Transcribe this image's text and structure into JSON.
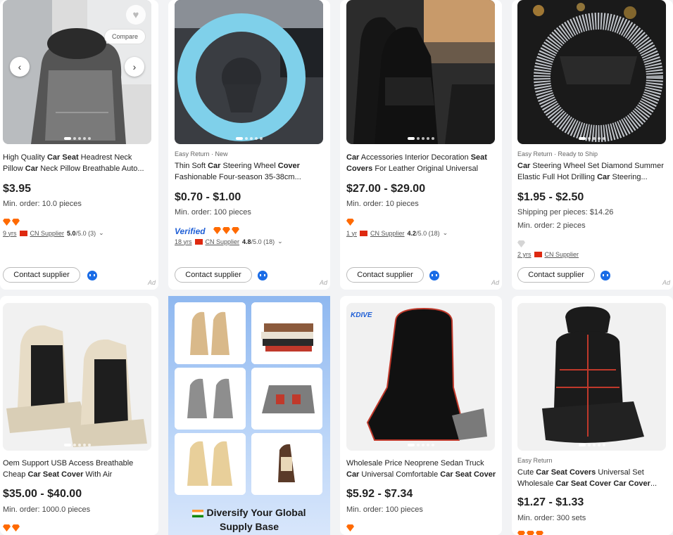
{
  "products": [
    {
      "tag": "",
      "title_parts": [
        {
          "t": "High Quality ",
          "b": false
        },
        {
          "t": "Car Seat",
          "b": true
        },
        {
          "t": " Headrest Neck Pillow ",
          "b": false
        },
        {
          "t": "Car",
          "b": true
        },
        {
          "t": " Neck Pillow Breathable Auto...",
          "b": false
        }
      ],
      "price": "$3.95",
      "moq": "Min. order: 10.0 pieces",
      "supplier": {
        "years": "9 yrs",
        "country": "CN Supplier",
        "rating": "5.0",
        "rating_of": "/5.0 (3)"
      },
      "contact": "Contact supplier",
      "ad": "Ad",
      "compare": "Compare"
    },
    {
      "tag": "Easy Return · New",
      "title_parts": [
        {
          "t": "Thin Soft ",
          "b": false
        },
        {
          "t": "Car",
          "b": true
        },
        {
          "t": " Steering Wheel ",
          "b": false
        },
        {
          "t": "Cover",
          "b": true
        },
        {
          "t": " Fashionable Four-season 35-38cm...",
          "b": false
        }
      ],
      "price": "$0.70 - $1.00",
      "moq": "Min. order: 100 pieces",
      "verified": "Verified",
      "supplier": {
        "years": "18 yrs",
        "country": "CN Supplier",
        "rating": "4.8",
        "rating_of": "/5.0 (18)"
      },
      "contact": "Contact supplier",
      "ad": "Ad"
    },
    {
      "tag": "",
      "title_parts": [
        {
          "t": "Car",
          "b": true
        },
        {
          "t": " Accessories Interior Decoration ",
          "b": false
        },
        {
          "t": "Seat Covers",
          "b": true
        },
        {
          "t": " For Leather Original Universal",
          "b": false
        }
      ],
      "price": "$27.00 - $29.00",
      "moq": "Min. order: 10 pieces",
      "supplier": {
        "years": "1 yr",
        "country": "CN Supplier",
        "rating": "4.2",
        "rating_of": "/5.0 (18)"
      },
      "contact": "Contact supplier",
      "ad": "Ad"
    },
    {
      "tag": "Easy Return · Ready to Ship",
      "title_parts": [
        {
          "t": "Car",
          "b": true
        },
        {
          "t": " Steering Wheel Set Diamond Summer Elastic Full Hot Drilling ",
          "b": false
        },
        {
          "t": "Car",
          "b": true
        },
        {
          "t": " Steering...",
          "b": false
        }
      ],
      "price": "$1.95 - $2.50",
      "shipping": "Shipping per pieces: $14.26",
      "moq": "Min. order: 2 pieces",
      "supplier": {
        "years": "2 yrs",
        "country": "CN Supplier"
      },
      "contact": "Contact supplier",
      "ad": "Ad"
    },
    {
      "tag": "",
      "title_parts": [
        {
          "t": "Oem Support USB Access Breathable Cheap ",
          "b": false
        },
        {
          "t": "Car Seat Cover",
          "b": true
        },
        {
          "t": " With Air",
          "b": false
        }
      ],
      "price": "$35.00 - $40.00",
      "moq": "Min. order: 1000.0 pieces"
    },
    {
      "tag": "",
      "title_parts": [
        {
          "t": "Wholesale Price Neoprene Sedan Truck ",
          "b": false
        },
        {
          "t": "Car",
          "b": true
        },
        {
          "t": " Universal Comfortable ",
          "b": false
        },
        {
          "t": "Car Seat Cover",
          "b": true
        }
      ],
      "price": "$5.92 - $7.34",
      "moq": "Min. order: 100 pieces",
      "brand_logo": "KDIVE"
    },
    {
      "tag": "Easy Return",
      "title_parts": [
        {
          "t": "Cute ",
          "b": false
        },
        {
          "t": "Car Seat Covers",
          "b": true
        },
        {
          "t": " Universal Set Wholesale ",
          "b": false
        },
        {
          "t": "Car Seat Cover Car Cover",
          "b": true
        },
        {
          "t": "...",
          "b": false
        }
      ],
      "price": "$1.27 - $1.33",
      "moq": "Min. order: 300 sets"
    }
  ],
  "promo": {
    "line1": "Diversify Your Global",
    "line2": "Supply Base"
  },
  "colors": {
    "accent_blue": "#1a6ce6",
    "diamond_orange": "#ff6a00",
    "flag_red": "#de2910"
  }
}
